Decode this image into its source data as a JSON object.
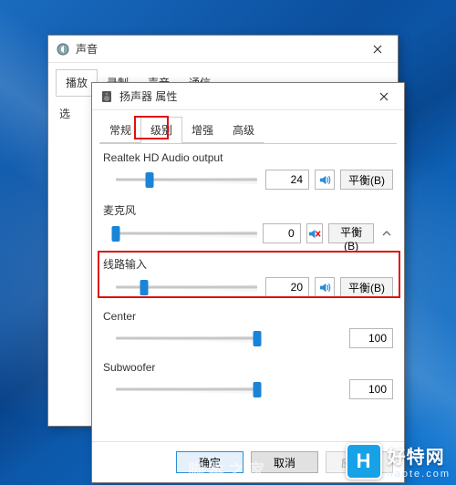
{
  "back_window": {
    "title": "声音",
    "tabs": [
      "播放",
      "录制",
      "声音",
      "通信"
    ],
    "cut_label": "选"
  },
  "front_window": {
    "title": "扬声器 属性",
    "tabs": [
      "常规",
      "级别",
      "增强",
      "高级"
    ],
    "active_tab_index": 1
  },
  "sliders": [
    {
      "label": "Realtek HD Audio output",
      "value": 24,
      "pct": 24,
      "muted": false,
      "balance": "平衡(B)"
    },
    {
      "label": "麦克风",
      "value": 0,
      "pct": 0,
      "muted": true,
      "balance": "平衡(B)",
      "highlight": true,
      "chevron": true
    },
    {
      "label": "线路输入",
      "value": 20,
      "pct": 20,
      "muted": false,
      "balance": "平衡(B)"
    },
    {
      "label": "Center",
      "value": 100,
      "pct": 100,
      "muted": false,
      "balance": null
    },
    {
      "label": "Subwoofer",
      "value": 100,
      "pct": 100,
      "muted": false,
      "balance": null
    }
  ],
  "buttons": {
    "ok": "确定",
    "cancel": "取消",
    "apply": "应用(A)"
  },
  "watermark": {
    "site": "好特网",
    "domain": "haote.com"
  },
  "watermark2": "脚本之家",
  "colors": {
    "accent": "#1a84d8",
    "highlight": "#d11"
  }
}
